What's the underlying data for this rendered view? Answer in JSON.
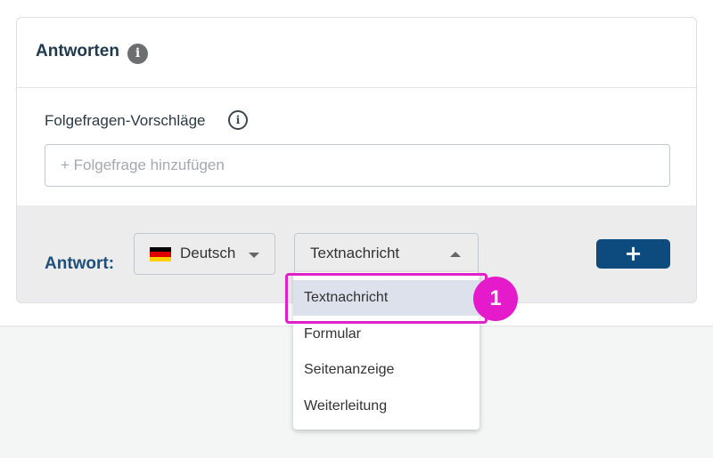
{
  "panel": {
    "title": "Antworten",
    "title_info_icon": "info-filled-icon"
  },
  "followup": {
    "label": "Folgefragen-Vorschläge",
    "info_icon": "info-outline-icon",
    "placeholder": "+ Folgefrage hinzufügen",
    "value": ""
  },
  "answer": {
    "label": "Antwort:",
    "language": {
      "selected": "Deutsch",
      "flag": "germany-flag-icon",
      "flag_colors": [
        "#000000",
        "#dd0000",
        "#ffce00"
      ]
    },
    "type": {
      "selected": "Textnachricht",
      "expanded": true
    },
    "add_button": "+"
  },
  "dropdown": {
    "items": [
      "Textnachricht",
      "Formular",
      "Seitenanzeige",
      "Weiterleitung"
    ],
    "selected_index": 0
  },
  "annotation": {
    "step": "1",
    "color": "#e51bcb"
  },
  "colors": {
    "accent": "#0d4a7e",
    "title": "#1e3a4c",
    "answer_label": "#1e4f7a",
    "selected_item_bg": "#dde1ec"
  }
}
